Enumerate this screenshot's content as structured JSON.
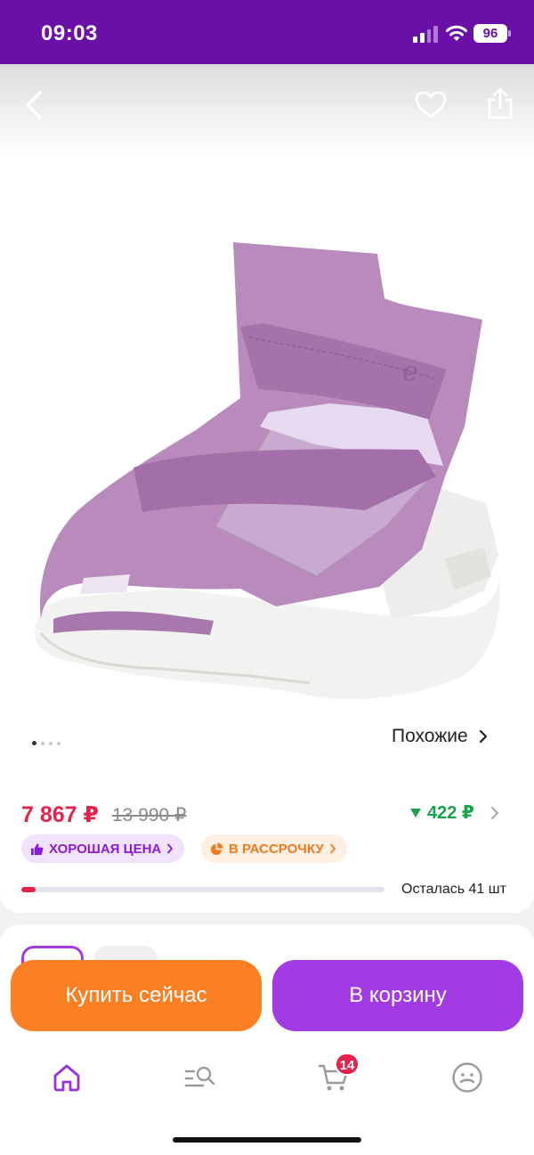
{
  "status_bar": {
    "time": "09:03",
    "battery": "96"
  },
  "product": {
    "price": "7 867 ₽",
    "old_price": "13 990 ₽",
    "discount_amount": "422 ₽",
    "similar_label": "Похожие",
    "image_count": 4,
    "active_image": 1
  },
  "tags": {
    "good_price": "ХОРОШАЯ ЦЕНА",
    "installments": "В РАССРОЧКУ"
  },
  "stock": {
    "label": "Осталась 41 шт",
    "level_fraction": 0.04
  },
  "actions": {
    "buy_now": "Купить сейчас",
    "add_to_cart": "В корзину"
  },
  "tabbar": {
    "cart_badge": "14",
    "items": [
      "home-icon",
      "catalog-search-icon",
      "cart-icon",
      "profile-icon"
    ]
  },
  "colors": {
    "brand_purple": "#6a0fa8",
    "accent_purple": "#a23be3",
    "price_red": "#e5224c",
    "cta_orange": "#fb7f23",
    "discount_green": "#17a34a"
  }
}
